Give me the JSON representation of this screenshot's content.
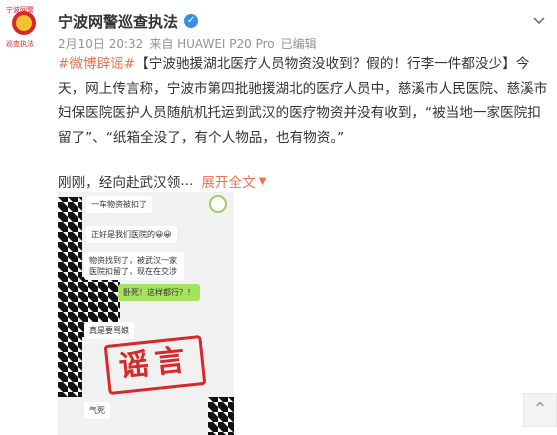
{
  "author": {
    "name": "宁波网警巡查执法",
    "avatar_text": [
      "宁波网警",
      "巡查执法"
    ]
  },
  "meta": {
    "date": "2月10日 20:32",
    "source": "来自 HUAWEI P20 Pro",
    "edited": "已编辑"
  },
  "post": {
    "hashtag": "#微博辟谣#",
    "body": "【宁波驰援湖北医疗人员物资没收到？假的！行李一件都没少】今天，网上传言称，宁波市第四批驰援湖北的医疗人员中，慈溪市人民医院、慈溪市妇保医院医护人员随航机托运到武汉的医疗物资并没有收到，“被当地一家医院扣留了”、“纸箱全没了，有个人物品，也有物资。”"
  },
  "summary": {
    "text": "刚刚，经向赴武汉领",
    "ellipsis": "...",
    "expand_label": "展开全文"
  },
  "chat": {
    "messages": [
      "一车物资被扣了",
      "正好是我们医院的😀😀",
      "物资找到了，被武汉一家医院扣留了，现在在交涉",
      "卧死！这样都行？！",
      "真是要骂娘",
      "气死"
    ],
    "stamp": "谣言"
  },
  "icons": {
    "verified": "verified-badge-icon",
    "chevron": "chevron-down-icon",
    "back_to_top": "arrow-up-icon"
  },
  "colors": {
    "accent": "#eb7350",
    "link_blue": "#3a8ee6",
    "stamp_red": "#d7282a",
    "chat_green": "#a6e15f"
  }
}
